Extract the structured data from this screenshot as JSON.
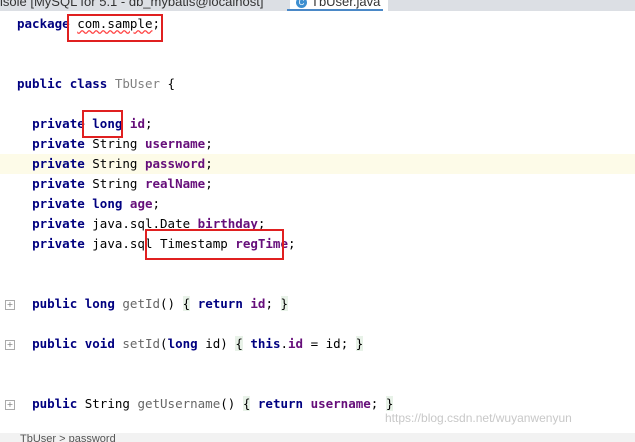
{
  "tabs": [
    {
      "label": "isole [MySQL for 5.1 - db_mybatis@localhost]"
    },
    {
      "label": "TbUser.java",
      "icon": "java-class-icon",
      "active": true
    }
  ],
  "code": {
    "kw_package": "package",
    "package_name": "com.sample",
    "semicolon": ";",
    "kw_public": "public",
    "kw_class": "class",
    "class_name": "TbUser",
    "open_brace": "{",
    "kw_private": "private",
    "kw_long": "long",
    "kw_void": "void",
    "kw_return": "return",
    "kw_this": "this",
    "type_string": "String",
    "type_date": "java.sql.Date",
    "type_ts_prefix": "java.sql",
    "type_ts": "Timestamp",
    "f_id": "id",
    "f_username": "username",
    "f_password": "password",
    "f_realname": "realName",
    "f_age": "age",
    "f_birthday": "birthday",
    "f_regtime": "regTime",
    "m_getid": "getId",
    "m_setid": "setId",
    "m_getusername": "getUsername",
    "empty_parens": "()",
    "param_open": "(",
    "param_name": "id)",
    "brace_open": "{",
    "brace_close": "}",
    "dot": ".",
    "assign_tail": " = id;"
  },
  "breadcrumb": {
    "class": "TbUser",
    "separator": ">",
    "member": "password"
  },
  "watermark": "https://blog.csdn.net/wuyanwenyun",
  "colors": {
    "keyword": "#000080",
    "field": "#660e7a",
    "annotation_box": "#e02020",
    "tab_accent": "#4a88c7"
  }
}
